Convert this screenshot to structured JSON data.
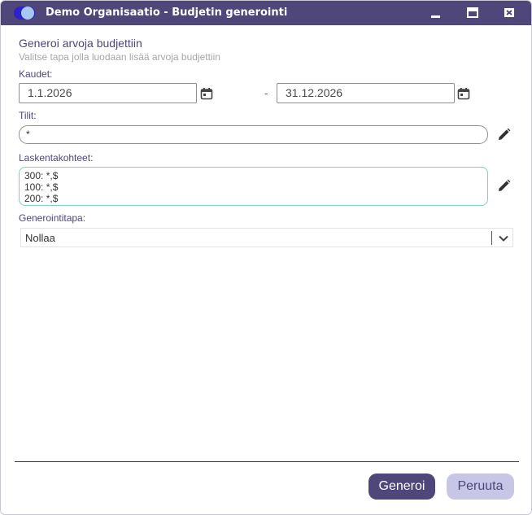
{
  "window": {
    "title": "Demo Organisaatio - Budjetin generointi",
    "accent_color": "#4f4679",
    "icons": {
      "logo": "toggle-logo-icon",
      "minimize": "minimize-icon",
      "maximize": "maximize-icon",
      "close": "close-icon"
    }
  },
  "form": {
    "heading": "Generoi arvoja budjettiin",
    "subheading": "Valitse tapa jolla luodaan lisää arvoja budjettiin",
    "periods": {
      "label": "Kaudet:",
      "start": "1.1.2026",
      "separator": "-",
      "end": "31.12.2026",
      "icon": "calendar-icon"
    },
    "accounts": {
      "label": "Tilit:",
      "value": "*",
      "icon": "edit-pencil-icon"
    },
    "cost_centers": {
      "label": "Laskentakohteet:",
      "lines": [
        "300: *,$",
        "100: *,$",
        "200: *,$"
      ],
      "icon": "edit-pencil-icon"
    },
    "method": {
      "label": "Generointitapa:",
      "selected": "Nollaa",
      "icon": "chevron-down-icon"
    }
  },
  "actions": {
    "generate_label": "Generoi",
    "cancel_label": "Peruuta"
  }
}
